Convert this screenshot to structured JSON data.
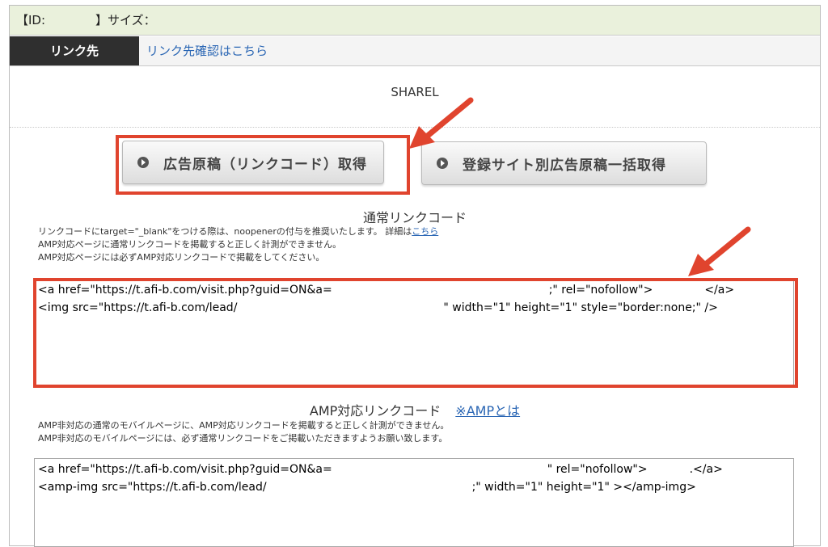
{
  "header": {
    "id_prefix": "【ID:",
    "id_suffix": "】サイズ：",
    "color": "#eaf1dc"
  },
  "link_row": {
    "label": "リンク先",
    "link_text": "リンク先確認はこちら"
  },
  "program_name": "SHAREL",
  "buttons": {
    "get_code": "広告原稿（リンクコード）取得",
    "bulk_get": "登録サイト別広告原稿一括取得",
    "icon": "play-circle-icon"
  },
  "normal_section": {
    "title": "通常リンクコード",
    "note_line1": "リンクコードにtarget=\"_blank\"をつける際は、noopenerの付与を推奨いたします。 詳細は",
    "note_link": "こちら",
    "note_line2": "AMP対応ページに通常リンクコードを掲載すると正しく計測ができません。",
    "note_line3": "AMP対応ページには必ずAMP対応リンクコードで掲載をしてください。",
    "code_line1_a": "<a href=\"https://t.afi-b.com/visit.php?guid=ON&a=",
    "code_line1_b": ";\" rel=\"nofollow\">",
    "code_line1_c": "</a>",
    "code_line2_a": "<img src=\"https://t.afi-b.com/lead/",
    "code_line2_b": "\" width=\"1\" height=\"1\" style=\"border:none;\" />"
  },
  "amp_section": {
    "title": "AMP対応リンクコード",
    "what_is_amp": "※AMPとは",
    "note_line1": "AMP非対応の通常のモバイルページに、AMP対応リンクコードを掲載すると正しく計測ができません。",
    "note_line2": "AMP非対応のモバイルページには、必ず通常リンクコードをご掲載いただきますようお願い致します。",
    "code_line1_a": "<a href=\"https://t.afi-b.com/visit.php?guid=ON&a=",
    "code_line1_b": "\" rel=\"nofollow\">",
    "code_line1_c": ".</a>",
    "code_line2_a": "<amp-img src=\"https://t.afi-b.com/lead/",
    "code_line2_b": ";\" width=\"1\" height=\"1\" ></amp-img>"
  },
  "highlight_color": "#e0442e"
}
